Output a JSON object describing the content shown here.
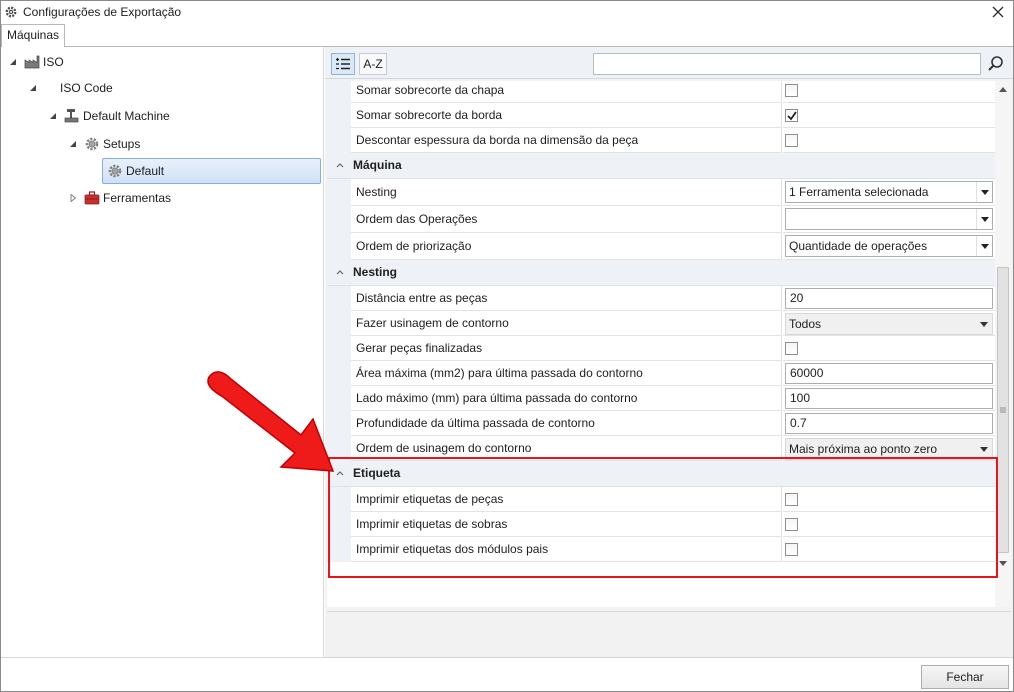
{
  "window": {
    "title": "Configurações de Exportação"
  },
  "tabs": [
    {
      "label": "Máquinas"
    }
  ],
  "tree": [
    {
      "label": "ISO",
      "icon": "factory-icon"
    },
    {
      "label": "ISO Code"
    },
    {
      "label": "Default Machine",
      "icon": "machine-icon"
    },
    {
      "label": "Setups",
      "icon": "gear-icon"
    },
    {
      "label": "Default",
      "icon": "gear-icon",
      "selected": true
    },
    {
      "label": "Ferramentas",
      "icon": "toolbox-icon"
    }
  ],
  "toolbar": {
    "alpha_label": "A-Z",
    "search_value": ""
  },
  "grid": {
    "top_rows": [
      {
        "label": "Somar sobrecorte da chapa",
        "checked": false
      },
      {
        "label": "Somar sobrecorte da borda",
        "checked": true
      },
      {
        "label": "Descontar espessura da borda na dimensão da peça",
        "checked": false
      }
    ],
    "maquina": {
      "title": "Máquina",
      "rows": [
        {
          "label": "Nesting",
          "value": "1 Ferramenta selecionada"
        },
        {
          "label": "Ordem das Operações",
          "value": ""
        },
        {
          "label": "Ordem de priorização",
          "value": "Quantidade de operações"
        }
      ]
    },
    "nesting": {
      "title": "Nesting",
      "rows": [
        {
          "label": "Distância entre as peças",
          "value": "20"
        },
        {
          "label": "Fazer usinagem de contorno",
          "value": "Todos"
        },
        {
          "label": "Gerar peças finalizadas",
          "checked": false
        },
        {
          "label": "Área máxima (mm2) para última passada do contorno",
          "value": "60000"
        },
        {
          "label": "Lado máximo (mm) para última passada do contorno",
          "value": "100"
        },
        {
          "label": "Profundidade da última passada de contorno",
          "value": "0.7"
        },
        {
          "label": "Ordem de usinagem do contorno",
          "value": "Mais próxima ao ponto zero"
        }
      ]
    },
    "etiqueta": {
      "title": "Etiqueta",
      "rows": [
        {
          "label": "Imprimir etiquetas de peças",
          "checked": false
        },
        {
          "label": "Imprimir etiquetas de sobras",
          "checked": false
        },
        {
          "label": "Imprimir etiquetas dos módulos pais",
          "checked": false
        }
      ]
    }
  },
  "footer": {
    "close_label": "Fechar"
  },
  "colors": {
    "annotation": "#e8141b",
    "selection": "#cfe1f6",
    "category_bg": "#eef1f5"
  }
}
